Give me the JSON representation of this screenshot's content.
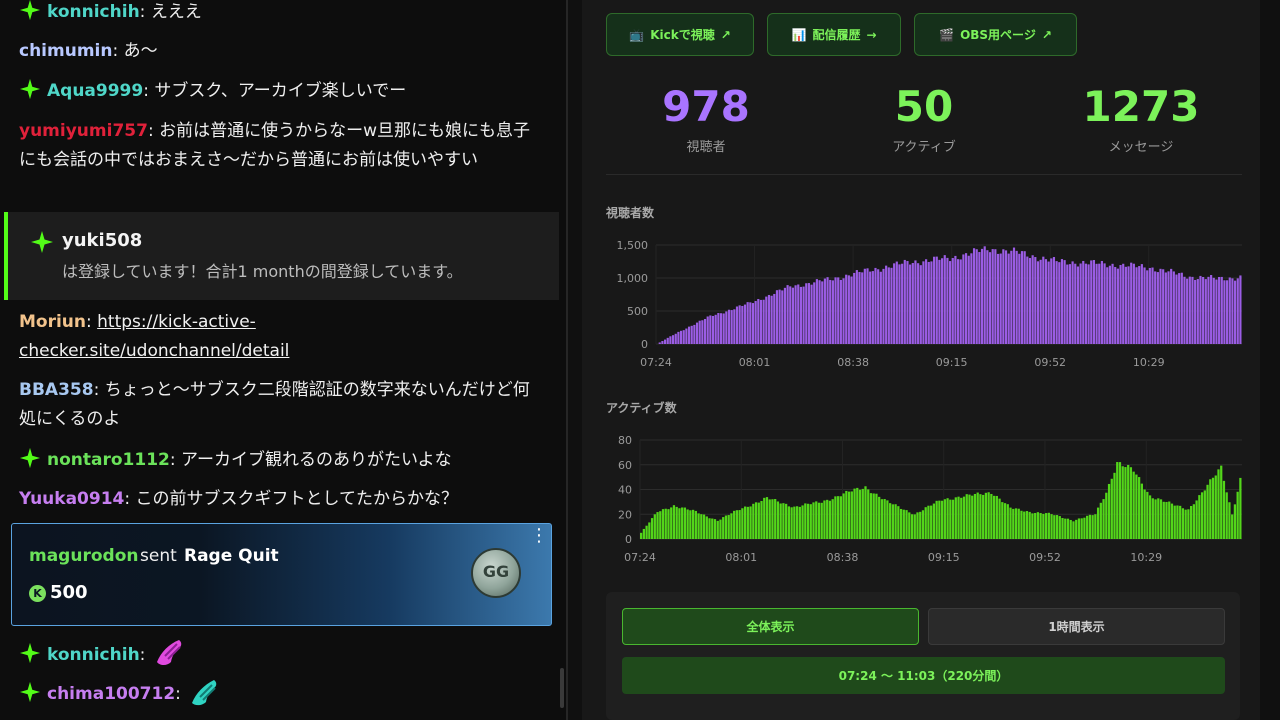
{
  "chat": {
    "messages": [
      {
        "user": "konnichih",
        "badge": "sparkle-badge",
        "user_color": "#4fd6c8",
        "text": "えええ"
      },
      {
        "user": "chimumin",
        "badge": null,
        "user_color": "#b8c8ff",
        "text": "あ〜"
      },
      {
        "user": "Aqua9999",
        "badge": "sparkle-badge",
        "user_color": "#4fd6c8",
        "text": "サブスク、アーカイブ楽しいでー"
      },
      {
        "user": "yumiyumi757",
        "badge": null,
        "user_color": "#e0213a",
        "text": "お前は普通に使うからなーw旦那にも娘にも息子にも会話の中ではおまえさ〜だから普通にお前は使いやすい"
      },
      {
        "user": "Moriun",
        "badge": null,
        "user_color": "#f2c38c",
        "text": "https://kick-active-checker.site/udonchannel/detail"
      },
      {
        "user": "BBA358",
        "badge": null,
        "user_color": "#a8c8f0",
        "text": "ちょっと〜サブスク二段階認証の数字来ないんだけど何処にくるのよ"
      },
      {
        "user": "nontaro1112",
        "badge": "sparkle-badge",
        "user_color": "#6be25a",
        "text": "アーカイブ観れるのありがたいよな"
      },
      {
        "user": "Yuuka0914",
        "badge": null,
        "user_color": "#c67ef0",
        "text": "この前サブスクギフトとしてたからかな？"
      },
      {
        "user": "konnichih",
        "badge": "sparkle-badge",
        "user_color": "#4fd6c8",
        "text": ""
      },
      {
        "user": "chima100712",
        "badge": "sparkle-badge",
        "user_color": "#c67ef0",
        "text": ""
      }
    ],
    "subscription": {
      "user": "yuki508",
      "text": "は登録しています！合計1 monthの間登録しています。"
    },
    "gift": {
      "user": "magurodon",
      "sent": "sent",
      "item": "Rage Quit",
      "amount": "500",
      "coin_symbol": "K",
      "coin_label": "GG"
    }
  },
  "buttons": {
    "kick": {
      "icon": "tv-icon",
      "label": "Kickで視聴",
      "arrow": "↗"
    },
    "history": {
      "icon": "bar-chart-icon",
      "label": "配信履歴",
      "arrow": "→"
    },
    "obs": {
      "icon": "clapper-icon",
      "label": "OBS用ページ",
      "arrow": "↗"
    }
  },
  "stats": {
    "viewers": {
      "value": "978",
      "label": "視聴者",
      "color": "#a974ff"
    },
    "active": {
      "value": "50",
      "label": "アクティブ",
      "color": "#7cf25a"
    },
    "messages": {
      "value": "1273",
      "label": "メッセージ",
      "color": "#7cf25a"
    }
  },
  "chart_data": [
    {
      "type": "bar",
      "title": "視聴者数",
      "color": "#9b5de5",
      "ylim": [
        0,
        1500
      ],
      "yticks": [
        "0",
        "500",
        "1,000",
        "1,500"
      ],
      "xticks": [
        "07:24",
        "08:01",
        "08:38",
        "09:15",
        "09:52",
        "10:29"
      ],
      "grid": true,
      "x_start": "07:24",
      "x_end": "11:03",
      "bar_count": 220,
      "profile": [
        [
          0,
          0
        ],
        [
          8,
          180
        ],
        [
          20,
          420
        ],
        [
          35,
          620
        ],
        [
          50,
          870
        ],
        [
          65,
          980
        ],
        [
          80,
          1120
        ],
        [
          95,
          1240
        ],
        [
          110,
          1300
        ],
        [
          120,
          1400
        ],
        [
          125,
          1440
        ],
        [
          135,
          1390
        ],
        [
          150,
          1250
        ],
        [
          165,
          1220
        ],
        [
          185,
          1160
        ],
        [
          200,
          1020
        ],
        [
          210,
          990
        ],
        [
          219,
          1010
        ]
      ]
    },
    {
      "type": "bar",
      "title": "アクティブ数",
      "color": "#53d61a",
      "ylim": [
        0,
        80
      ],
      "yticks": [
        "0",
        "20",
        "40",
        "60",
        "80"
      ],
      "xticks": [
        "07:24",
        "08:01",
        "08:38",
        "09:15",
        "09:52",
        "10:29"
      ],
      "grid": true,
      "x_start": "07:24",
      "x_end": "11:03",
      "bar_count": 220,
      "profile": [
        [
          0,
          5
        ],
        [
          6,
          22
        ],
        [
          12,
          27
        ],
        [
          20,
          22
        ],
        [
          28,
          15
        ],
        [
          36,
          24
        ],
        [
          46,
          33
        ],
        [
          56,
          26
        ],
        [
          66,
          30
        ],
        [
          76,
          38
        ],
        [
          82,
          42
        ],
        [
          90,
          30
        ],
        [
          100,
          20
        ],
        [
          110,
          32
        ],
        [
          120,
          35
        ],
        [
          128,
          38
        ],
        [
          135,
          25
        ],
        [
          142,
          22
        ],
        [
          150,
          20
        ],
        [
          158,
          15
        ],
        [
          166,
          20
        ],
        [
          170,
          38
        ],
        [
          174,
          62
        ],
        [
          180,
          55
        ],
        [
          186,
          35
        ],
        [
          194,
          28
        ],
        [
          200,
          24
        ],
        [
          206,
          40
        ],
        [
          212,
          58
        ],
        [
          216,
          20
        ],
        [
          219,
          48
        ]
      ]
    }
  ],
  "range": {
    "all_label": "全体表示",
    "hour_label": "1時間表示",
    "span_label": "07:24 〜 11:03（220分間）"
  }
}
